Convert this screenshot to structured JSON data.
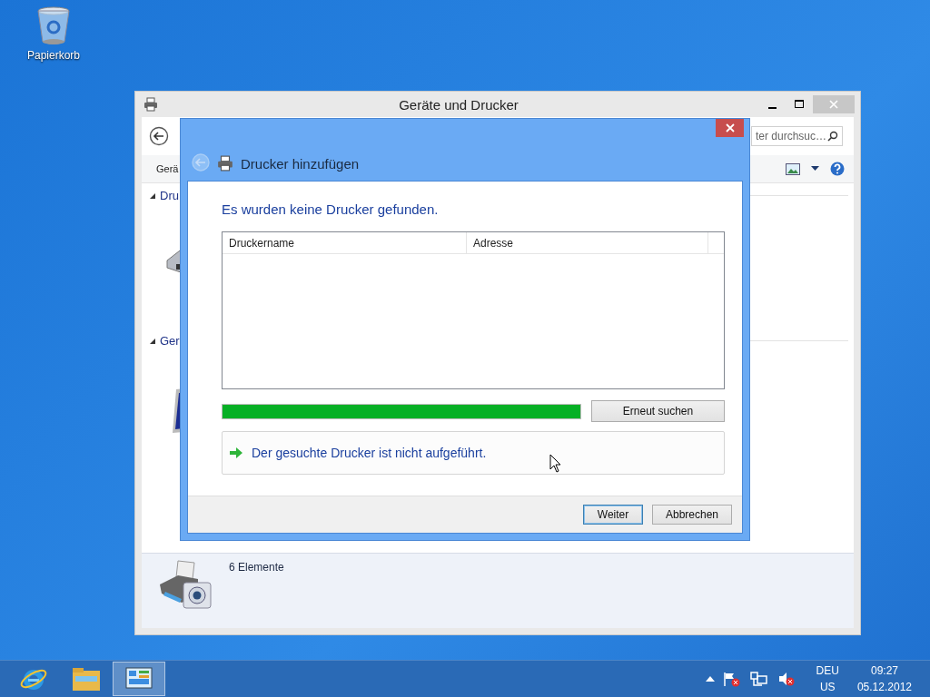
{
  "desktop": {
    "icons": [
      {
        "label": "Papierkorb"
      }
    ]
  },
  "main_window": {
    "title": "Geräte und Drucker",
    "search": {
      "placeholder": "ter durchsuc…"
    },
    "toolbar": {
      "label": "Gerä"
    },
    "groups": [
      {
        "label": "Dru",
        "expanded": true,
        "kind": "printer"
      },
      {
        "label": "Ger",
        "expanded": true,
        "kind": "monitor"
      }
    ],
    "details": {
      "count": "6 Elemente"
    }
  },
  "dialog": {
    "title": "Drucker hinzufügen",
    "heading": "Es wurden keine Drucker gefunden.",
    "table": {
      "columns": [
        "Druckername",
        "Adresse"
      ]
    },
    "progress": {
      "level": 1
    },
    "search_again": "Erneut suchen",
    "link": "Der gesuchte Drucker ist nicht aufgeführt.",
    "buttons": [
      {
        "label": "Weiter",
        "default": true
      },
      {
        "label": "Abbrechen",
        "default": false
      }
    ]
  },
  "taskbar": {
    "items": [
      {
        "kind": "browser",
        "selected": false
      },
      {
        "kind": "folder",
        "selected": false
      },
      {
        "kind": "control-panel",
        "selected": true
      }
    ],
    "tray": {
      "language": "DEU",
      "layout": "US",
      "time": "09:27",
      "date": "05.12.2012"
    }
  }
}
